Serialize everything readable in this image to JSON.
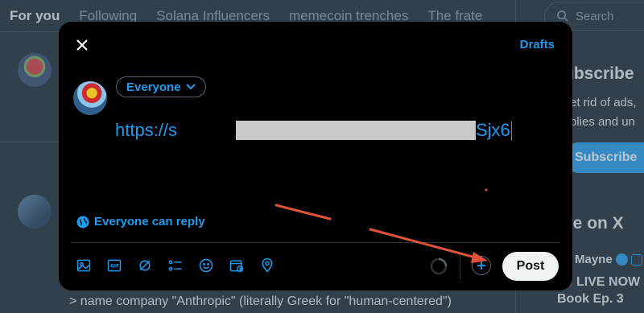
{
  "feed": {
    "tabs": [
      "For you",
      "Following",
      "Solana Influencers",
      "memecoin trenches",
      "The frate"
    ],
    "active_tab": 0,
    "bottom_text": "> name company \"Anthropic\" (literally Greek for \"human-centered\")"
  },
  "search": {
    "placeholder": "Search"
  },
  "sidebar": {
    "subscribe_heading": "ubscribe",
    "subscribe_line1": "et rid of ads,",
    "subscribe_line2": "plies and un",
    "subscribe_button": "Subscribe",
    "live_heading": "ve on X",
    "live_name": "Mayne",
    "live_now": "LIVE NOW -",
    "live_title": "Book Ep. 3"
  },
  "compose": {
    "drafts": "Drafts",
    "audience": "Everyone",
    "url_start": "https://s",
    "url_end": "Sjx6",
    "reply_setting": "Everyone can reply",
    "post_button": "Post"
  },
  "colors": {
    "accent": "#1d9bf0",
    "annotation_arrow": "#e0523a"
  },
  "icons": [
    "image-icon",
    "gif-icon",
    "grok-icon",
    "poll-icon",
    "emoji-icon",
    "schedule-icon",
    "location-icon"
  ]
}
